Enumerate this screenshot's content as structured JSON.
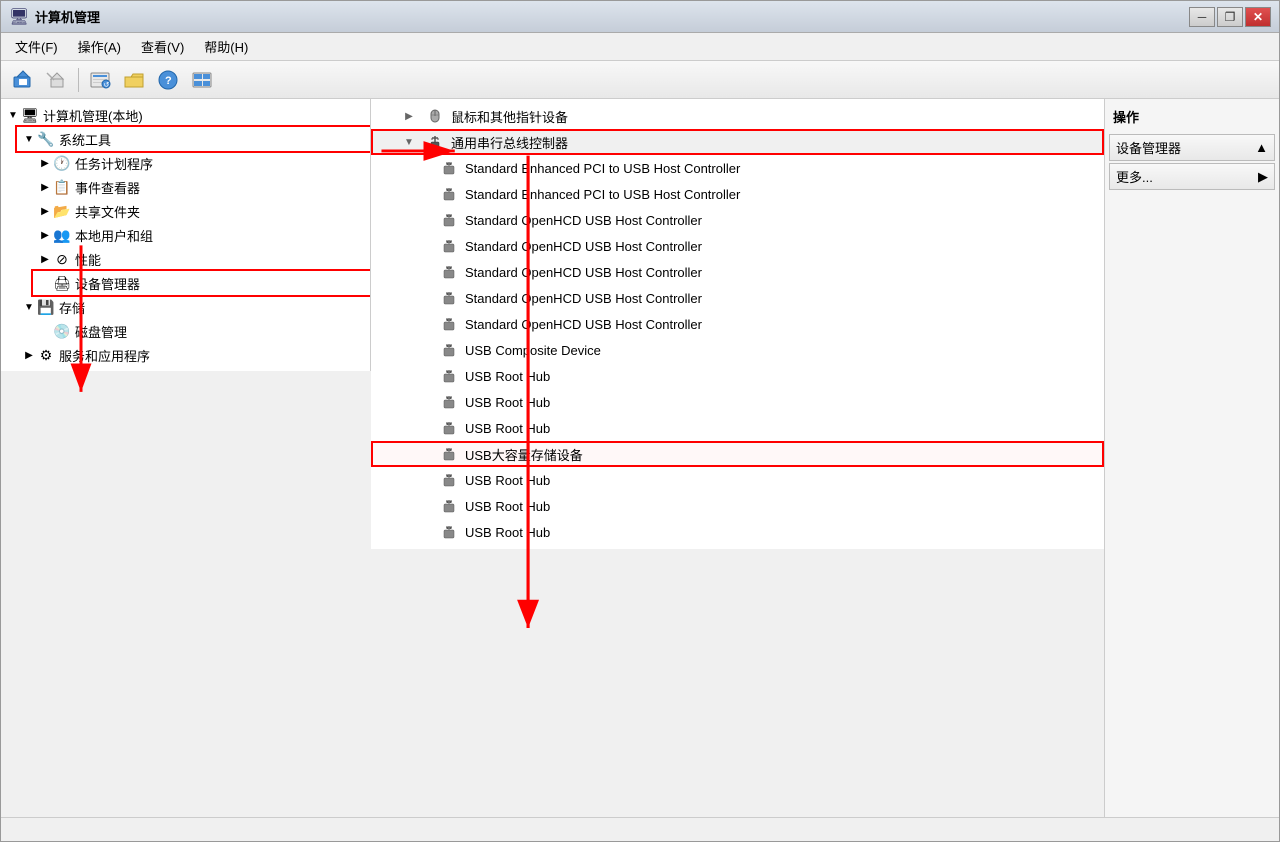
{
  "window": {
    "title": "计算机管理",
    "icon": "🖥"
  },
  "titlebar_buttons": {
    "minimize": "─",
    "restore": "❐",
    "close": "✕"
  },
  "menu": {
    "items": [
      {
        "label": "文件(F)"
      },
      {
        "label": "操作(A)"
      },
      {
        "label": "查看(V)"
      },
      {
        "label": "帮助(H)"
      }
    ]
  },
  "toolbar": {
    "buttons": [
      {
        "name": "back",
        "icon": "◀"
      },
      {
        "name": "forward",
        "icon": "▶"
      },
      {
        "name": "up",
        "icon": "📁"
      },
      {
        "name": "folder",
        "icon": "🗂"
      },
      {
        "name": "question",
        "icon": "?"
      },
      {
        "name": "list",
        "icon": "▦"
      }
    ]
  },
  "left_panel": {
    "root": "计算机管理(本地)",
    "items": [
      {
        "label": "系统工具",
        "expanded": true,
        "highlighted": true,
        "level": 1,
        "icon": "🔧"
      },
      {
        "label": "任务计划程序",
        "level": 2,
        "icon": "🕐"
      },
      {
        "label": "事件查看器",
        "level": 2,
        "icon": "📋"
      },
      {
        "label": "共享文件夹",
        "level": 2,
        "icon": "📂"
      },
      {
        "label": "本地用户和组",
        "level": 2,
        "icon": "👥"
      },
      {
        "label": "性能",
        "level": 2,
        "icon": "⊘"
      },
      {
        "label": "设备管理器",
        "level": 2,
        "icon": "🖨",
        "highlighted": true
      },
      {
        "label": "存储",
        "expanded": true,
        "level": 1,
        "icon": "💾"
      },
      {
        "label": "磁盘管理",
        "level": 2,
        "icon": "💿"
      },
      {
        "label": "服务和应用程序",
        "level": 1,
        "icon": "⚙"
      }
    ]
  },
  "center_panel": {
    "category": {
      "label": "通用串行总线控制器",
      "highlighted": true
    },
    "devices": [
      {
        "label": "Standard Enhanced PCI to USB Host Controller",
        "icon": "usb"
      },
      {
        "label": "Standard Enhanced PCI to USB Host Controller",
        "icon": "usb"
      },
      {
        "label": "Standard OpenHCD USB Host Controller",
        "icon": "usb"
      },
      {
        "label": "Standard OpenHCD USB Host Controller",
        "icon": "usb"
      },
      {
        "label": "Standard OpenHCD USB Host Controller",
        "icon": "usb"
      },
      {
        "label": "Standard OpenHCD USB Host Controller",
        "icon": "usb"
      },
      {
        "label": "Standard OpenHCD USB Host Controller",
        "icon": "usb"
      },
      {
        "label": "USB Composite Device",
        "icon": "usb"
      },
      {
        "label": "USB Root Hub",
        "icon": "usb"
      },
      {
        "label": "USB Root Hub",
        "icon": "usb"
      },
      {
        "label": "USB Root Hub",
        "icon": "usb"
      },
      {
        "label": "USB大容量存储设备",
        "icon": "usb",
        "highlighted": true
      },
      {
        "label": "USB Root Hub",
        "icon": "usb"
      },
      {
        "label": "USB Root Hub",
        "icon": "usb"
      },
      {
        "label": "USB Root Hub",
        "icon": "usb"
      }
    ],
    "top_item": {
      "label": "鼠标和其他指针设备"
    }
  },
  "right_panel": {
    "title": "操作",
    "actions": [
      {
        "label": "设备管理器",
        "has_arrow": true
      },
      {
        "label": "更多...",
        "has_arrow": true
      }
    ]
  },
  "status_bar": {
    "text": ""
  }
}
